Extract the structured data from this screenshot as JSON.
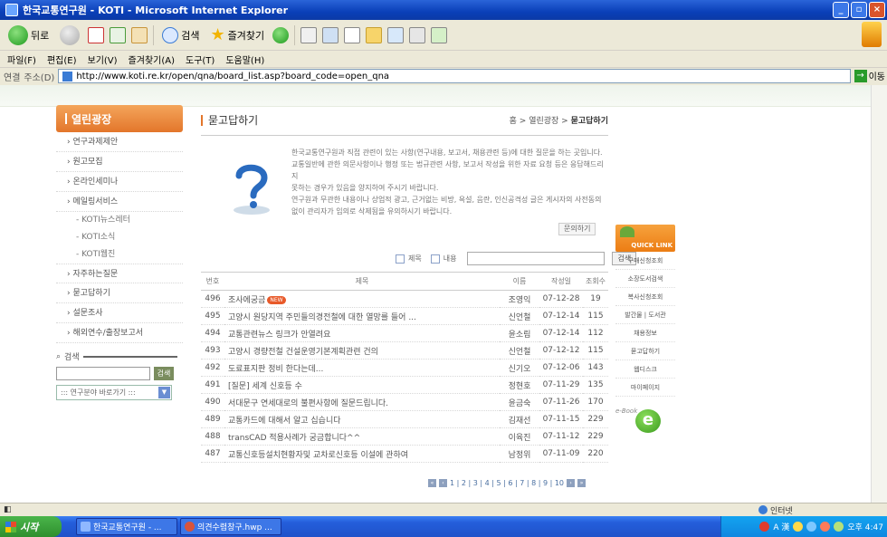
{
  "window": {
    "title": "한국교통연구원 - KOTI - Microsoft Internet Explorer",
    "controls": [
      "_",
      "▫",
      "×"
    ]
  },
  "toolbar": {
    "back_label": "뒤로",
    "search_label": "검색",
    "favorites_label": "즐겨찾기"
  },
  "menu": [
    "파일(F)",
    "편집(E)",
    "보기(V)",
    "즐겨찾기(A)",
    "도구(T)",
    "도움말(H)"
  ],
  "address": {
    "links_label": "연결",
    "address_label": "주소(D)",
    "url": "http://www.koti.re.kr/open/qna/board_list.asp?board_code=open_qna",
    "go_label": "이동"
  },
  "left_nav": {
    "heading": "열린광장",
    "items": [
      {
        "label": "› 연구과제제안"
      },
      {
        "label": "› 원고모집"
      },
      {
        "label": "› 온라인세미나"
      },
      {
        "label": "› 메일링서비스"
      }
    ],
    "sub_items": [
      {
        "label": "- KOTI뉴스레터"
      },
      {
        "label": "- KOTI소식"
      },
      {
        "label": "- KOTI웹진"
      }
    ],
    "items2": [
      {
        "label": "› 자주하는질문"
      },
      {
        "label": "› 묻고답하기"
      },
      {
        "label": "› 설문조사"
      },
      {
        "label": "› 해외연수/출장보고서"
      }
    ],
    "search_title": "검색",
    "search_button": "검색",
    "select_label": "::: 연구분야 바로가기 :::"
  },
  "main": {
    "title": "묻고답하기",
    "breadcrumb_prefix": "홈 > 열린광장 > ",
    "breadcrumb_current": "묻고답하기",
    "intro_lines": [
      "한국교통연구원과 직접 관련이 있는 사항(연구내용, 보고서, 채용관련 등)에 대한 질문을 하는 곳입니다.",
      "교통일반에 관한 의문사항이나 행정 또는 법규관련 사항, 보고서 작성을 위한 자료 요청 등은 응답해드리지",
      "못하는 경우가 있음을 양지하여 주시기 바랍니다.",
      "연구원과 무관한 내용이나 상업적 광고, 근거없는 비방, 욕설, 음란, 인신공격성 글은 게시자의 사전동의",
      "없이 관리자가 임의로 삭제됨을 유의하시기 바랍니다."
    ],
    "ask_button": "문의하기",
    "filter_title": "제목",
    "filter_content": "내용",
    "filter_search": "검색",
    "columns": [
      "번호",
      "제목",
      "이름",
      "작성일",
      "조회수"
    ],
    "rows": [
      {
        "no": "496",
        "title": "조사에궁금",
        "new": "NEW",
        "name": "조영익",
        "date": "07-12-28",
        "views": "19"
      },
      {
        "no": "495",
        "title": "고양시 원당지역 주민들의경전철에 대한 열망를 들어 ...",
        "new": "",
        "name": "신언철",
        "date": "07-12-14",
        "views": "115"
      },
      {
        "no": "494",
        "title": "교통관련뉴스 링크가 안열려요",
        "new": "",
        "name": "윤소림",
        "date": "07-12-14",
        "views": "112"
      },
      {
        "no": "493",
        "title": "고양시 경량전철 건설운영기본계획관련 건의",
        "new": "",
        "name": "신언철",
        "date": "07-12-12",
        "views": "115"
      },
      {
        "no": "492",
        "title": "도료표지판 정비 한다는데...",
        "new": "",
        "name": "신기오",
        "date": "07-12-06",
        "views": "143"
      },
      {
        "no": "491",
        "title": "[질문] 세계 신호등 수",
        "new": "",
        "name": "정현호",
        "date": "07-11-29",
        "views": "135"
      },
      {
        "no": "490",
        "title": "서대문구 연세대로의 불편사항에 질문드립니다.",
        "new": "",
        "name": "윤금숙",
        "date": "07-11-26",
        "views": "170"
      },
      {
        "no": "489",
        "title": "교통카드에 대해서 알고 십습니다",
        "new": "",
        "name": "김재선",
        "date": "07-11-15",
        "views": "229"
      },
      {
        "no": "488",
        "title": "transCAD 적용사례가 궁금합니다^^",
        "new": "",
        "name": "이육진",
        "date": "07-11-12",
        "views": "229"
      },
      {
        "no": "487",
        "title": "교통신호등설치현황자및 교차로신호등 이설에 관하여",
        "new": "",
        "name": "남정위",
        "date": "07-11-09",
        "views": "220"
      }
    ],
    "pager": "1 | 2 | 3 | 4 | 5 | 6 | 7 | 8 | 9 | 10"
  },
  "quick_link": {
    "heading": "QUICK LINK",
    "items": [
      "구매신청조회",
      "소장도서검색",
      "복사신청조회",
      "발간물 | 도서관",
      "채용정보",
      "묻고답하기",
      "웹디스크",
      "마이페이지"
    ],
    "ebook_label": "e-Book",
    "ebook_letter": "e"
  },
  "statusbar": {
    "zone": "인터넷"
  },
  "taskbar": {
    "start": "시작",
    "tasks": [
      "한국교통연구원 - ...",
      "의견수렴창구.hwp ..."
    ],
    "tray_lang": "A 漢",
    "clock": "오후 4:47"
  },
  "colors": {
    "title_bar": "#0a3fb8",
    "nav_header": "#e3762b",
    "quick_link": "#ec7d14"
  }
}
